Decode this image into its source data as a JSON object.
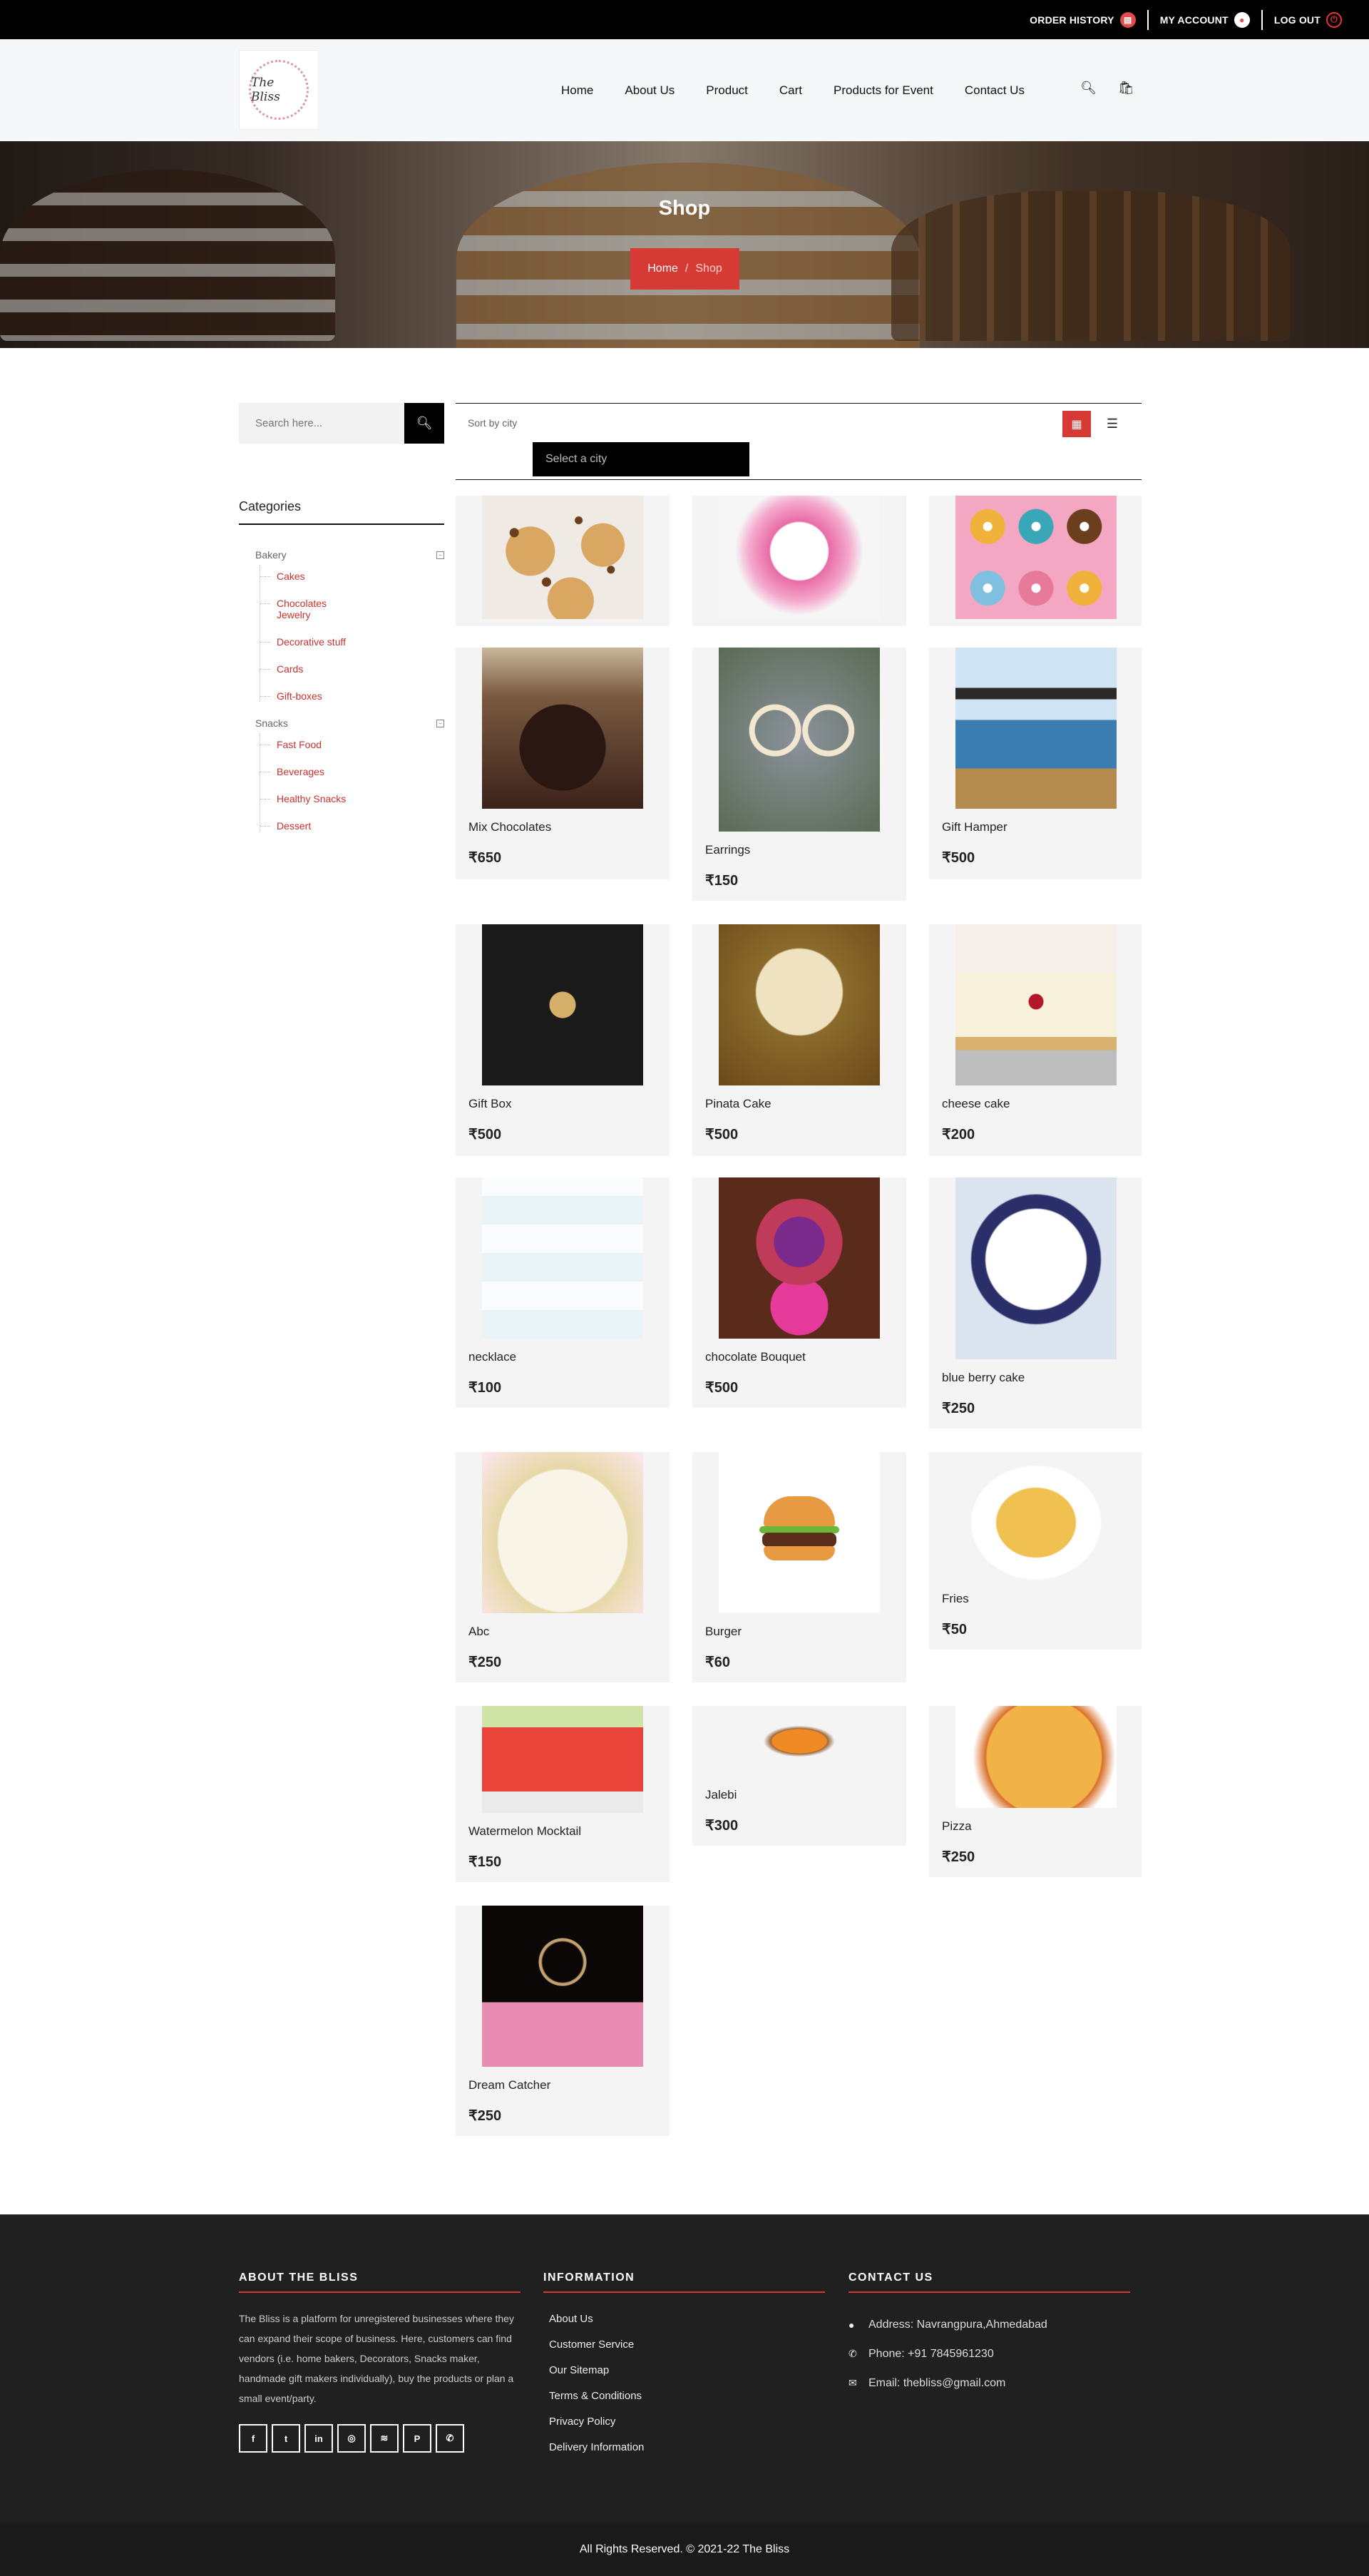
{
  "topbar": {
    "order_history": "ORDER HISTORY",
    "my_account": "MY ACCOUNT",
    "log_out": "LOG OUT"
  },
  "logo": {
    "text": "The Bliss"
  },
  "nav": {
    "items": [
      "Home",
      "About Us",
      "Product",
      "Cart",
      "Products for Event",
      "Contact Us"
    ]
  },
  "hero": {
    "title": "Shop",
    "breadcrumb_home": "Home",
    "breadcrumb_sep": "/",
    "breadcrumb_current": "Shop"
  },
  "search": {
    "placeholder": "Search here..."
  },
  "categories": {
    "title": "Categories",
    "groups": [
      {
        "name": "Bakery",
        "items": [
          "Cakes",
          "Chocolates Jewelry",
          "Decorative stuff",
          "Cards",
          "Gift-boxes"
        ]
      },
      {
        "name": "Snacks",
        "items": [
          "Fast Food",
          "Beverages",
          "Healthy Snacks",
          "Dessert"
        ]
      }
    ]
  },
  "toolbar": {
    "sort_label": "Sort by city",
    "city_placeholder": "Select a city"
  },
  "currency": "₹",
  "products": [
    {
      "name": "",
      "price": "",
      "icon": "cookies"
    },
    {
      "name": "",
      "price": "",
      "icon": "pink-rose-cake"
    },
    {
      "name": "",
      "price": "",
      "icon": "donuts"
    },
    {
      "name": "Mix Chocolates",
      "price": "₹650",
      "icon": "chocolate-box"
    },
    {
      "name": "Earrings",
      "price": "₹150",
      "icon": "earrings"
    },
    {
      "name": "Gift Hamper",
      "price": "₹500",
      "icon": "gift-hamper"
    },
    {
      "name": "Gift Box",
      "price": "₹500",
      "icon": "gift-box"
    },
    {
      "name": "Pinata Cake",
      "price": "₹500",
      "icon": "pinata-cake"
    },
    {
      "name": "cheese cake",
      "price": "₹200",
      "icon": "cheese-cake"
    },
    {
      "name": "necklace",
      "price": "₹100",
      "icon": "card"
    },
    {
      "name": "chocolate Bouquet",
      "price": "₹500",
      "icon": "chocolate-bouquet"
    },
    {
      "name": "blue berry cake",
      "price": "₹250",
      "icon": "blueberry-cake"
    },
    {
      "name": "Abc",
      "price": "₹250",
      "icon": "birthday-cake"
    },
    {
      "name": "Burger",
      "price": "₹60",
      "icon": "burger"
    },
    {
      "name": "Fries",
      "price": "₹50",
      "icon": "fries"
    },
    {
      "name": "Watermelon Mocktail",
      "price": "₹150",
      "icon": "mocktail"
    },
    {
      "name": "Jalebi",
      "price": "₹300",
      "icon": "jalebi"
    },
    {
      "name": "Pizza",
      "price": "₹250",
      "icon": "pizza"
    },
    {
      "name": "Dream Catcher",
      "price": "₹250",
      "icon": "dream-catcher"
    }
  ],
  "footer": {
    "about_title": "ABOUT THE BLISS",
    "about_text": "The Bliss is a platform for unregistered businesses where they can expand their scope of business. Here, customers can find vendors (i.e. home bakers, Decorators, Snacks maker, handmade gift makers individually), buy the products or plan a small event/party.",
    "info_title": "INFORMATION",
    "info_links": [
      "About Us",
      "Customer Service",
      "Our Sitemap",
      "Terms & Conditions",
      "Privacy Policy",
      "Delivery Information"
    ],
    "contact_title": "CONTACT US",
    "address": "Address: Navrangpura,Ahmedabad",
    "phone": "Phone: +91 7845961230",
    "email": "Email: thebliss@gmail.com",
    "socials": [
      "facebook-icon",
      "twitter-icon",
      "linkedin-icon",
      "dribbble-icon",
      "rss-icon",
      "pinterest-icon",
      "whatsapp-icon"
    ],
    "copyright": "All Rights Reserved. © 2021-22 The Bliss"
  },
  "colors": {
    "accent": "#d63a35",
    "dark": "#202020"
  }
}
